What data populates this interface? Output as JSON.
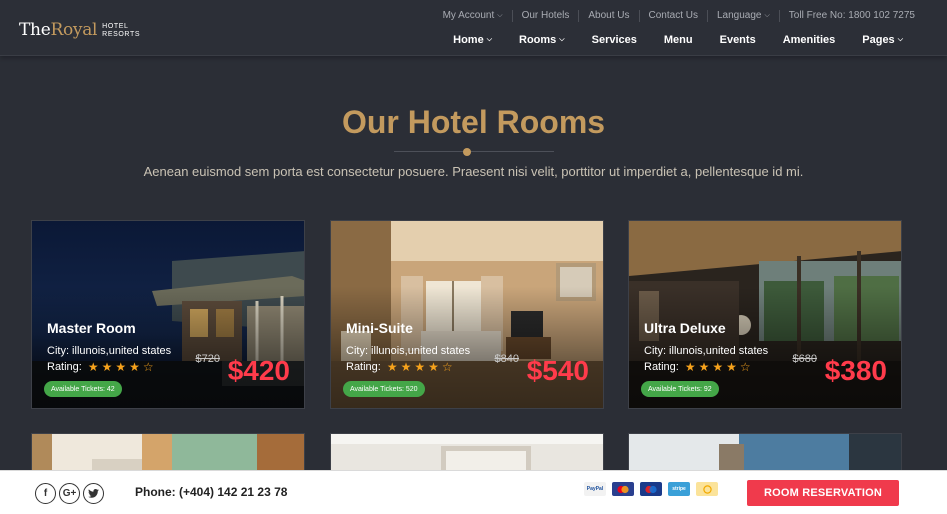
{
  "brand": {
    "logo_the": "The",
    "logo_royal": "Royal",
    "logo_sub1": "HOTEL",
    "logo_sub2": "RESORTS"
  },
  "topbar": {
    "items": [
      "My Account",
      "Our Hotels",
      "About Us",
      "Contact Us",
      "Language",
      "Toll Free No: 1800 102 7275"
    ]
  },
  "nav": {
    "items": [
      "Home",
      "Rooms",
      "Services",
      "Menu",
      "Events",
      "Amenities",
      "Pages"
    ]
  },
  "section": {
    "title": "Our Hotel Rooms",
    "subtitle": "Aenean euismod sem porta est consectetur posuere. Praesent nisi velit, porttitor ut imperdiet a, pellentesque id mi."
  },
  "rooms": [
    {
      "name": "Master Room",
      "city": "City: illunois,united states",
      "rating_label": "Rating:",
      "rating": 4,
      "old_price": "$720",
      "price": "$420",
      "tickets": "Available Tickets: 42"
    },
    {
      "name": "Mini-Suite",
      "city": "City: illunois,united states",
      "rating_label": "Rating:",
      "rating": 4,
      "old_price": "$840",
      "price": "$540",
      "tickets": "Available Tickets: 520"
    },
    {
      "name": "Ultra Deluxe",
      "city": "City: illunois,united states",
      "rating_label": "Rating:",
      "rating": 4,
      "old_price": "$680",
      "price": "$380",
      "tickets": "Available Tickets: 92"
    }
  ],
  "footer": {
    "social": [
      "f",
      "G+",
      "t"
    ],
    "phone": "Phone: (+404) 142 21 23 78",
    "payments": [
      "PayPal",
      "",
      "",
      "stripe",
      ""
    ],
    "reserve_label": "ROOM RESERVATION"
  },
  "colors": {
    "accent": "#c39a5e",
    "price": "#ff3b4b",
    "reserve": "#f03a4c",
    "tickets": "#44a648"
  }
}
